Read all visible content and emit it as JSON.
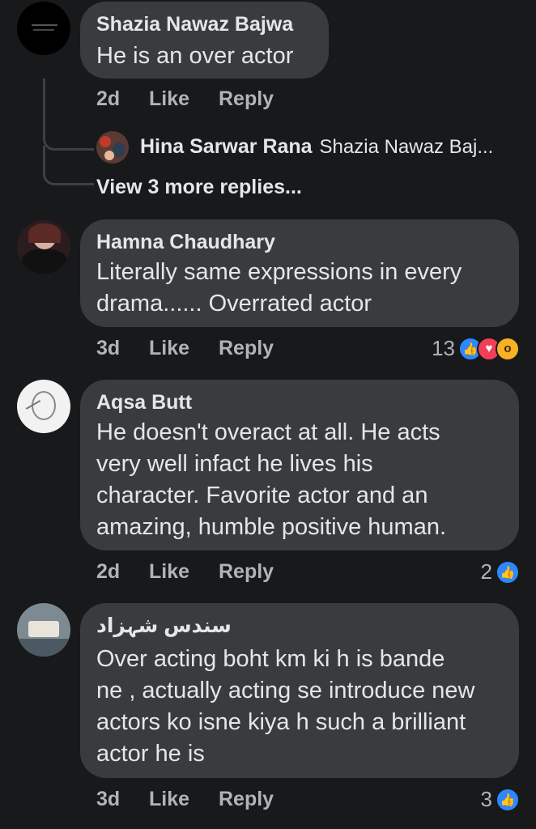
{
  "comments": [
    {
      "author": "Shazia Nawaz Bajwa",
      "text": "He is an over actor",
      "time": "2d",
      "like": "Like",
      "reply": "Reply",
      "nested_reply": {
        "author": "Hina Sarwar Rana",
        "preview": "Shazia Nawaz Baj..."
      },
      "view_more": "View 3 more replies..."
    },
    {
      "author": "Hamna Chaudhary",
      "lines": [
        "Literally same expressions in every",
        "drama...... Overrated actor"
      ],
      "time": "3d",
      "like": "Like",
      "reply": "Reply",
      "reaction_count": "13",
      "reactions": [
        "like",
        "love",
        "wow"
      ]
    },
    {
      "author": "Aqsa Butt",
      "lines": [
        "He doesn't overact at all. He acts",
        "very well infact he lives his",
        "character. Favorite actor and an",
        "amazing, humble positive human."
      ],
      "time": "2d",
      "like": "Like",
      "reply": "Reply",
      "reaction_count": "2",
      "reactions": [
        "like"
      ]
    },
    {
      "author": "سندس شہزاد",
      "lines": [
        "Over acting boht km ki h is bande",
        "ne , actually acting se introduce new",
        "actors ko isne kiya h such a brilliant",
        "actor he is"
      ],
      "time": "3d",
      "like": "Like",
      "reply": "Reply",
      "reaction_count": "3",
      "reactions": [
        "like"
      ]
    }
  ],
  "colors": {
    "background": "#18191a",
    "bubble": "#3a3b3c",
    "primary_text": "#e4e6eb",
    "secondary_text": "#b0b3b8",
    "like_blue": "#2d88ff",
    "love_red": "#f33e58",
    "wow_yellow": "#f7b125"
  }
}
